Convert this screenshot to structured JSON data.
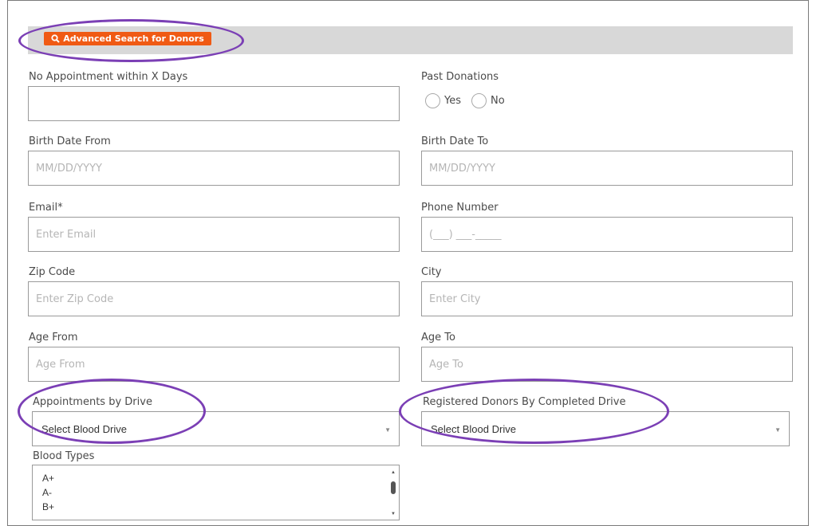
{
  "header": {
    "advanced_search_label": "Advanced Search for Donors"
  },
  "form": {
    "no_appointment": {
      "label": "No Appointment within X Days",
      "value": ""
    },
    "past_donations": {
      "label": "Past Donations",
      "yes": "Yes",
      "no": "No"
    },
    "birth_from": {
      "label": "Birth Date From",
      "placeholder": "MM/DD/YYYY"
    },
    "birth_to": {
      "label": "Birth Date To",
      "placeholder": "MM/DD/YYYY"
    },
    "email": {
      "label": "Email*",
      "placeholder": "Enter Email"
    },
    "phone": {
      "label": "Phone Number",
      "placeholder": "(___) ___-_____"
    },
    "zip": {
      "label": "Zip Code",
      "placeholder": "Enter Zip Code"
    },
    "city": {
      "label": "City",
      "placeholder": "Enter City"
    },
    "age_from": {
      "label": "Age From",
      "placeholder": "Age From"
    },
    "age_to": {
      "label": "Age To",
      "placeholder": "Age To"
    },
    "appointments_by_drive": {
      "label": "Appointments by Drive",
      "selected": "Select Blood Drive"
    },
    "registered_by_completed": {
      "label": "Registered Donors By Completed Drive",
      "selected": "Select Blood Drive"
    },
    "blood_types": {
      "label": "Blood Types",
      "options": [
        "A+",
        "A-",
        "B+"
      ]
    }
  },
  "colors": {
    "accent": "#f05a14",
    "annotation": "#7b3fb5",
    "header_bar": "#d8d8d8"
  },
  "icons": {
    "search": "search-icon",
    "dropdown": "chevron-down-icon"
  }
}
